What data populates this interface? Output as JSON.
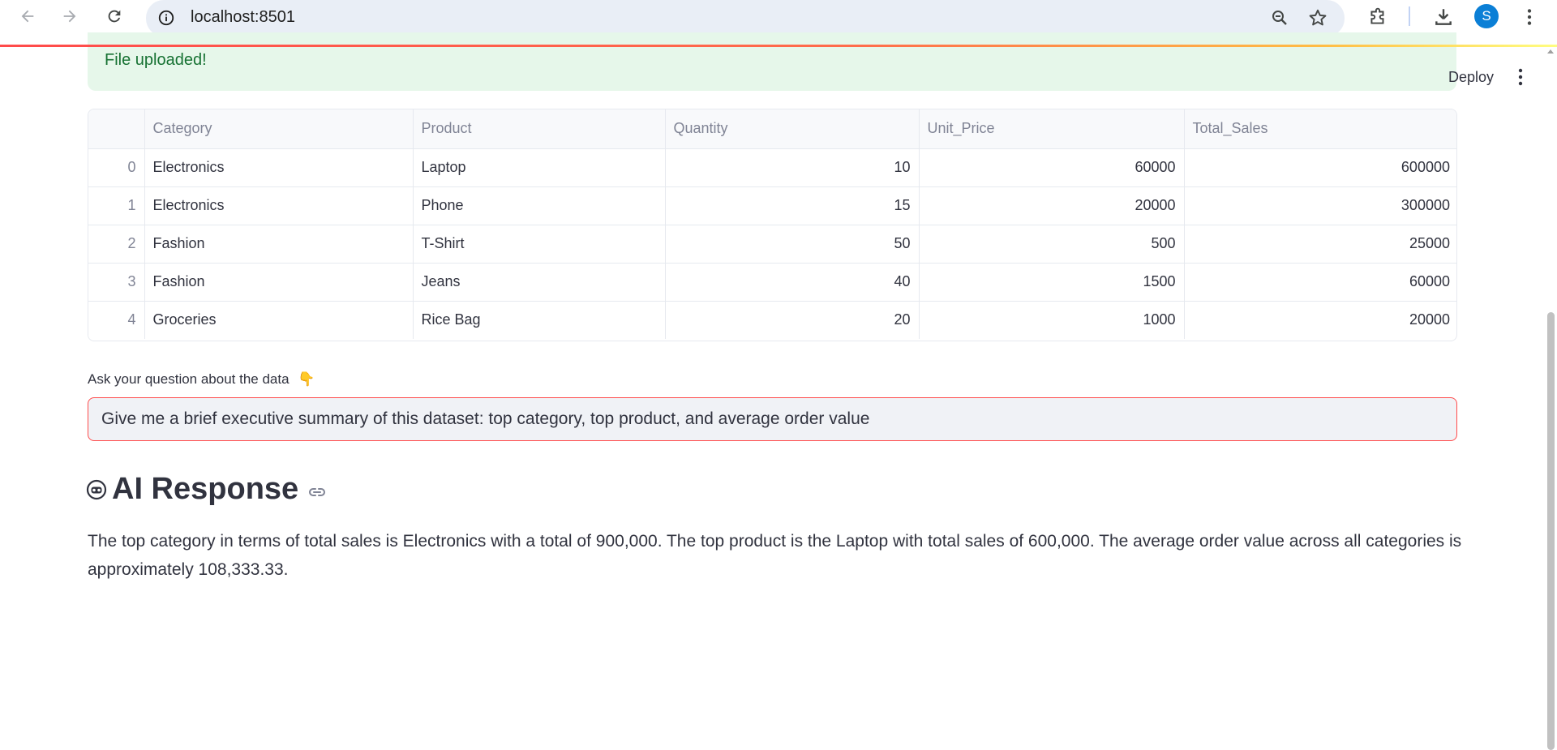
{
  "browser": {
    "url": "localhost:8501",
    "avatar_letter": "S",
    "icons": [
      "back-icon",
      "forward-icon",
      "reload-icon",
      "info-icon",
      "zoom-icon",
      "star-icon",
      "extensions-icon",
      "download-icon",
      "more-vert-icon"
    ]
  },
  "app": {
    "deploy_label": "Deploy",
    "alert_text": "File uploaded!",
    "table": {
      "columns": [
        "",
        "Category",
        "Product",
        "Quantity",
        "Unit_Price",
        "Total_Sales"
      ],
      "rows": [
        [
          "0",
          "Electronics",
          "Laptop",
          "10",
          "60000",
          "600000"
        ],
        [
          "1",
          "Electronics",
          "Phone",
          "15",
          "20000",
          "300000"
        ],
        [
          "2",
          "Fashion",
          "T-Shirt",
          "50",
          "500",
          "25000"
        ],
        [
          "3",
          "Fashion",
          "Jeans",
          "40",
          "1500",
          "60000"
        ],
        [
          "4",
          "Groceries",
          "Rice Bag",
          "20",
          "1000",
          "20000"
        ]
      ]
    },
    "question_label": "Ask your question about the data",
    "question_emoji": "👇",
    "question_value": "Give me a brief executive summary of this dataset: top category, top product, and average order value",
    "response_heading": "AI Response",
    "response_text": "The top category in terms of total sales is Electronics with a total of 900,000. The top product is the Laptop with total sales of 600,000. The average order value across all categories is approximately 108,333.33."
  },
  "colors": {
    "accent": "#ff4b4b",
    "success_bg": "#e6f7ea",
    "success_text": "#177233",
    "avatar": "#0b7fd6"
  }
}
